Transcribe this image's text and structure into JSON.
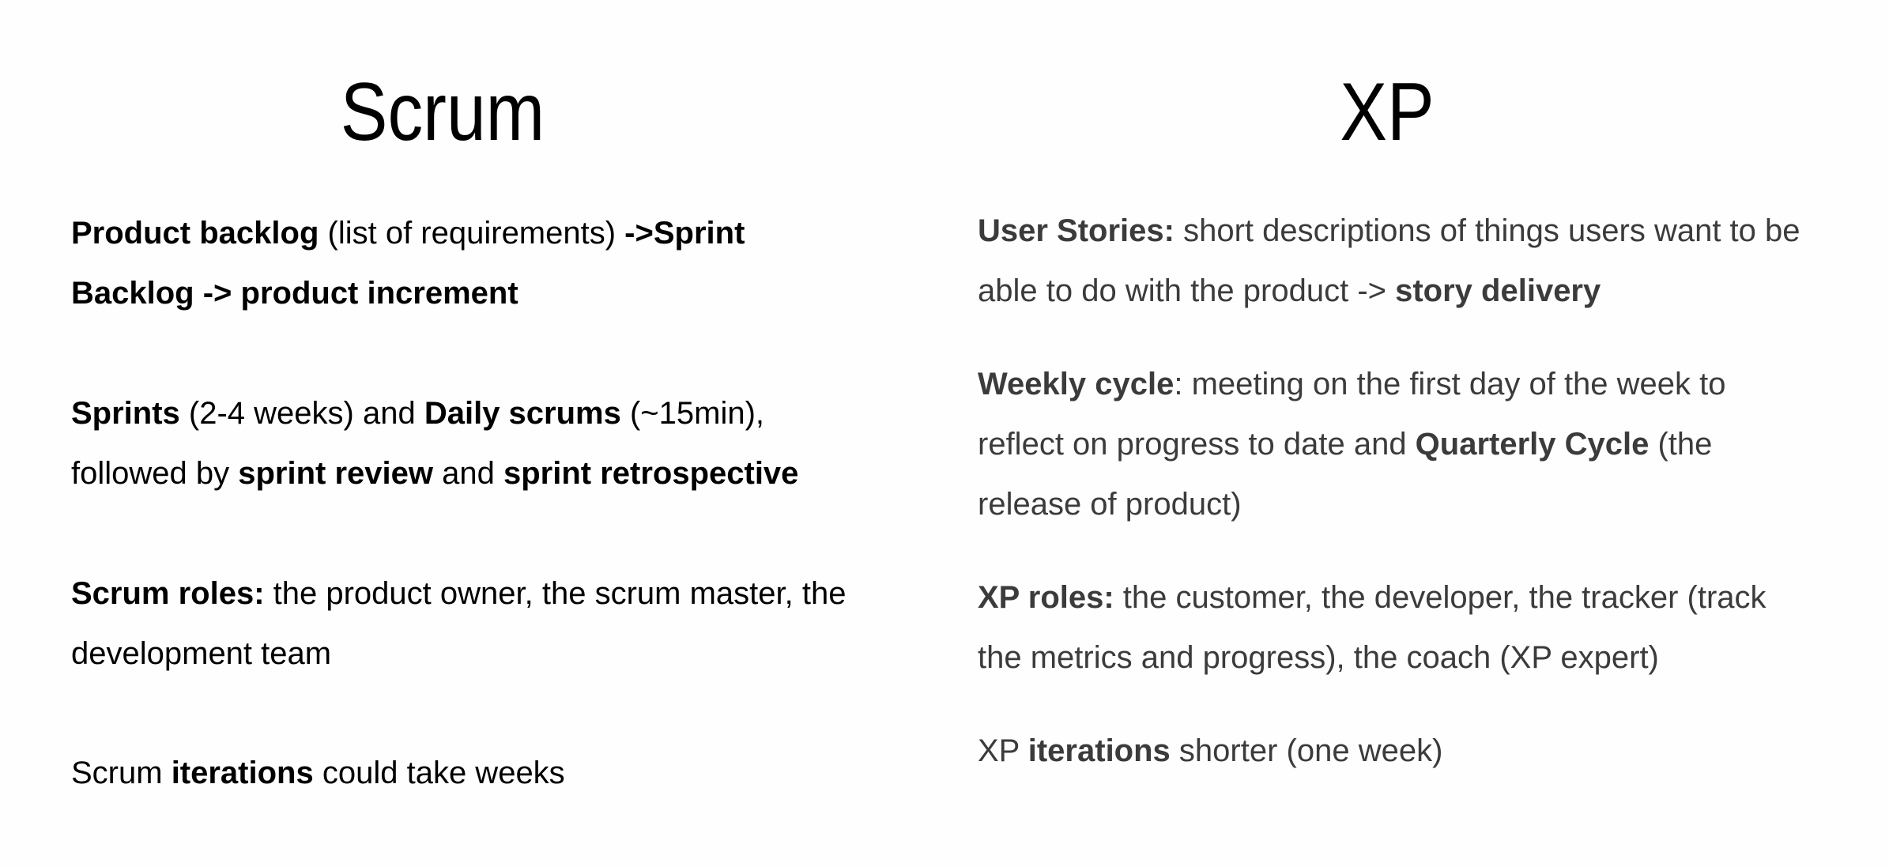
{
  "scrum": {
    "title": "Scrum",
    "p1": {
      "s1": "Product backlog",
      "s2": " (list of requirements) ",
      "s3": "->Sprint Backlog -> product increment"
    },
    "p2": {
      "s1": "Sprints",
      "s2": " (2-4 weeks) and ",
      "s3": "Daily scrums",
      "s4": " (~15min), followed by ",
      "s5": "sprint review",
      "s6": " and ",
      "s7": "sprint retrospective"
    },
    "p3": {
      "s1": "Scrum roles:",
      "s2": " the product owner, the scrum master, the development team"
    },
    "p4": {
      "s1": "Scrum ",
      "s2": "iterations",
      "s3": " could take weeks"
    }
  },
  "xp": {
    "title": "XP",
    "p1": {
      "s1": "User Stories:",
      "s2": " short descriptions of things users want to be able to do with the product -> ",
      "s3": "story delivery"
    },
    "p2": {
      "s1": "Weekly cycle",
      "s2": ": meeting on the first day of the week to reflect on progress to date and ",
      "s3": "Quarterly Cycle",
      "s4": " (the release of product)"
    },
    "p3": {
      "s1": "XP roles:",
      "s2": " the customer, the developer, the tracker (track the metrics and progress), the coach (XP expert)"
    },
    "p4": {
      "s1": "XP ",
      "s2": "iterations",
      "s3": " shorter (one week)"
    }
  }
}
